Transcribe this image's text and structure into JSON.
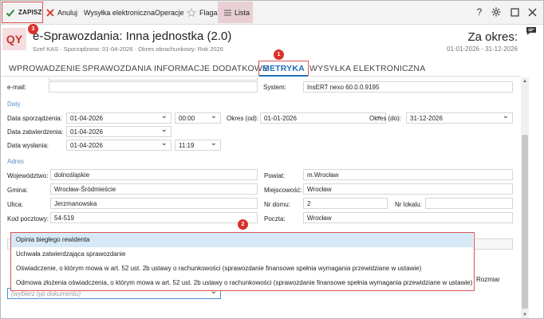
{
  "toolbar": {
    "save": "ZAPISZ",
    "cancel": "Anuluj",
    "send": "Wysyłka elektroniczna",
    "operations": "Operacje",
    "flag": "Flaga",
    "list": "Lista",
    "help": "?"
  },
  "header": {
    "logo": "QY",
    "title": "e-Sprawozdania: Inna jednostka (2.0)",
    "meta": "Szef KAS  ·  Sporządzono: 01-04-2026  ·  Okres obrachunkowy: Rok 2026",
    "period_label": "Za okres:",
    "period_value": "01-01-2026 - 31-12-2026"
  },
  "tabs": [
    "WPROWADZENIE",
    "SPRAWOZDANIA",
    "INFORMACJE DODATKOWE",
    "METRYKA",
    "WYSYŁKA ELEKTRONICZNA"
  ],
  "badges": [
    "1",
    "2",
    "3"
  ],
  "form": {
    "email_label": "e-mail:",
    "system_label": "System:",
    "system_value": "InsERT nexo 60.0.0.9195",
    "dates_section": "Daty",
    "date_prepared_label": "Data sporządzenia:",
    "date_prepared": "01-04-2026",
    "time_prepared": "00:00",
    "period_from_label": "Okres (od):",
    "period_from": "01-01-2026",
    "period_to_label": "Okres (do):",
    "period_to": "31-12-2026",
    "date_approved_label": "Data zatwierdzenia:",
    "date_approved": "01-04-2026",
    "date_sent_label": "Data wysłania:",
    "date_sent": "01-04-2026",
    "time_sent": "11:19",
    "address_section": "Adres",
    "voivodeship_label": "Województwo:",
    "voivodeship": "dolnośląskie",
    "county_label": "Powiat:",
    "county": "m.Wrocław",
    "commune_label": "Gmina:",
    "commune": "Wrocław-Śródmieście",
    "locality_label": "Miejscowość:",
    "locality": "Wrocław",
    "street_label": "Ulica:",
    "street": "Jerzmanowska",
    "house_no_label": "Nr domu:",
    "house_no": "2",
    "flat_no_label": "Nr lokalu:",
    "flat_no": "",
    "postcode_label": "Kod pocztowy:",
    "postcode": "54-519",
    "post_office_label": "Poczta:",
    "post_office": "Wrocław"
  },
  "dropdown": {
    "options": [
      "Opinia biegłego rewidenta",
      "Uchwała zatwierdzająca sprawozdanie",
      "Oświadczenie, o którym mowa w art. 52 ust. 2b ustawy o rachunkowości (sprawozdanie finansowe spełnia wymagania przewidziane w ustawie)",
      "Odmowa złożenia oświadczenia, o którym mowa w art. 52 ust. 2b ustawy o rachunkowości (sprawozdanie finansowe spełnia wymagania przewidziane w ustawie)"
    ],
    "selected": 0,
    "placeholder": "(wybierz typ dokumentu)",
    "size_column": "Rozmiar"
  }
}
